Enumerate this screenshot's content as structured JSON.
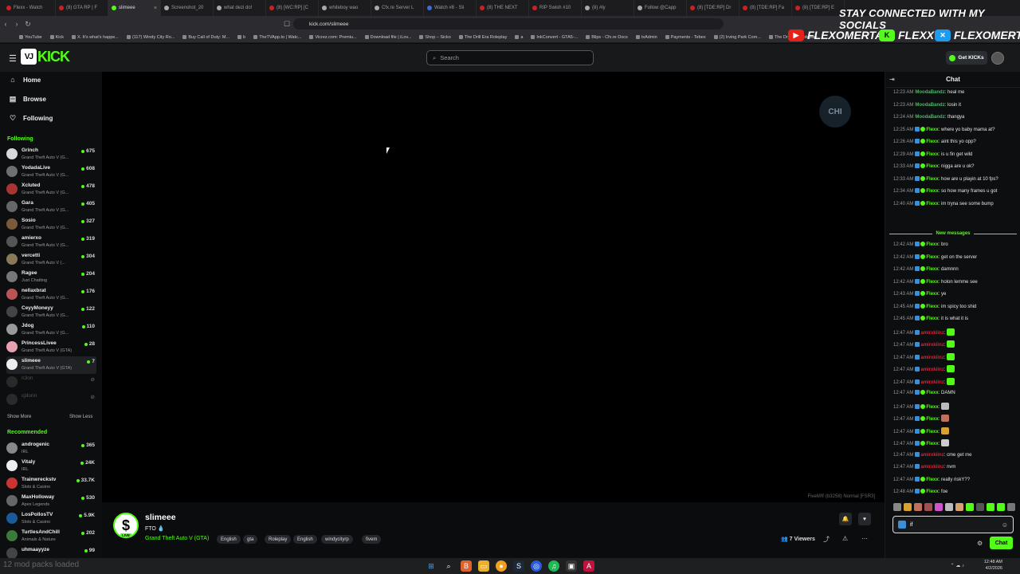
{
  "browser": {
    "tabs": [
      {
        "label": "Flexx - Watch",
        "icon": "red"
      },
      {
        "label": "(8) GTA RP | F",
        "icon": "red"
      },
      {
        "label": "slimeee",
        "icon": "green",
        "active": true
      },
      {
        "label": "Screenshot_20",
        "icon": "white"
      },
      {
        "label": "what dezi do!",
        "icon": "white"
      },
      {
        "label": "(8) [WC:RP] [C",
        "icon": "red"
      },
      {
        "label": "whiteboy wao",
        "icon": "white"
      },
      {
        "label": "Cfx.re Server L",
        "icon": "white"
      },
      {
        "label": "Watch #8 - Sli",
        "icon": "blue"
      },
      {
        "label": "(8) THE NEXT",
        "icon": "red"
      },
      {
        "label": "RIP Swish #10",
        "icon": "red"
      },
      {
        "label": "(8) #ly",
        "icon": "white"
      },
      {
        "label": "Follow @Capp",
        "icon": "white"
      },
      {
        "label": "(8) [TDE:RP] Dr",
        "icon": "red"
      },
      {
        "label": "(8) [TDE:RP] Fa",
        "icon": "red"
      },
      {
        "label": "(8) [TDE:RP] E",
        "icon": "red"
      }
    ],
    "url": "kick.com/slimeee",
    "bookmarks": [
      "YouTube",
      "Kick",
      "X. It's what's happe...",
      "(117) Windy City Ro...",
      "Buy Call of Duty: M...",
      "b",
      "TheTVApp.to | Watc...",
      "Vicrez.com: Premiu...",
      "Download file | iLov...",
      "Shop – Sicko",
      "The Drill Era Roleplay",
      "a",
      "InkConvert - GTA5-...",
      "Blips - Cfx.re Docs",
      "txAdmin",
      "Payments - Tebex",
      "(2) Irving Park Com...",
      "The Drill Era Roleplay"
    ]
  },
  "overlay": {
    "headline": "STAY CONNECTED WITH MY SOCIALS",
    "handles": [
      {
        "name": "FLEXOMERTA",
        "icon": "youtube-icon",
        "color": "#e62117"
      },
      {
        "name": "FLEXX",
        "icon": "kick-icon",
        "color": "#53fc18"
      },
      {
        "name": "FLEXOMERTA",
        "icon": "twitter-icon",
        "color": "#1d9bf0"
      }
    ]
  },
  "header": {
    "logo_text": "KICK",
    "search_placeholder": "Search",
    "get_kicks": "Get KICKs"
  },
  "nav": {
    "home": "Home",
    "browse": "Browse",
    "following": "Following"
  },
  "sidebar": {
    "following_title": "Following",
    "following": [
      {
        "name": "Grinch",
        "category": "Grand Theft Auto V (G...",
        "viewers": "675",
        "avatar": "#d8d8d8"
      },
      {
        "name": "YodadaLive",
        "category": "Grand Theft Auto V (G...",
        "viewers": "608",
        "avatar": "#6f6f6f"
      },
      {
        "name": "Xcluted",
        "category": "Grand Theft Auto V (G...",
        "viewers": "478",
        "avatar": "#a33"
      },
      {
        "name": "Gara",
        "category": "Grand Theft Auto V (G...",
        "viewers": "405",
        "avatar": "#666"
      },
      {
        "name": "Sosio",
        "category": "Grand Theft Auto V (G...",
        "viewers": "327",
        "avatar": "#7a5a3a"
      },
      {
        "name": "amierxo",
        "category": "Grand Theft Auto V (G...",
        "viewers": "319",
        "avatar": "#555"
      },
      {
        "name": "vercetti",
        "category": "Grand Theft Auto V (...",
        "viewers": "304",
        "avatar": "#8a7a5a"
      },
      {
        "name": "Ragee",
        "category": "Just Chatting",
        "viewers": "204",
        "avatar": "#777"
      },
      {
        "name": "nellaxbrat",
        "category": "Grand Theft Auto V (G...",
        "viewers": "176",
        "avatar": "#b55"
      },
      {
        "name": "CeyyMoneyy",
        "category": "Grand Theft Auto V (G...",
        "viewers": "122",
        "avatar": "#444"
      },
      {
        "name": "Jdog",
        "category": "Grand Theft Auto V (G...",
        "viewers": "110",
        "avatar": "#999"
      },
      {
        "name": "PrincessLivee",
        "category": "Grand Theft Auto V (GTA)",
        "viewers": "28",
        "avatar": "#e8a0b0"
      },
      {
        "name": "slimeee",
        "category": "Grand Theft Auto V (GTA)",
        "viewers": "7",
        "avatar": "#eee"
      }
    ],
    "offline": [
      "n3on",
      "cjdonn"
    ],
    "show_more": "Show More",
    "show_less": "Show Less",
    "recommended_title": "Recommended",
    "recommended": [
      {
        "name": "androgenic",
        "category": "IRL",
        "viewers": "365",
        "avatar": "#888"
      },
      {
        "name": "Vitaly",
        "category": "IRL",
        "viewers": "24K",
        "avatar": "#eee"
      },
      {
        "name": "Trainwreckstv",
        "category": "Slots & Casino",
        "viewers": "33.7K",
        "avatar": "#c33"
      },
      {
        "name": "MaxHolloway",
        "category": "Apex Legends",
        "viewers": "530",
        "avatar": "#666"
      },
      {
        "name": "LosPollosTV",
        "category": "Slots & Casino",
        "viewers": "5.9K",
        "avatar": "#1a5a9a"
      },
      {
        "name": "TurtlesAndChill",
        "category": "Animals & Nature",
        "viewers": "202",
        "avatar": "#3a7a3a"
      },
      {
        "name": "uhmaayyze",
        "category": "",
        "viewers": "99",
        "avatar": "#444"
      }
    ]
  },
  "player": {
    "watermark": "CHI",
    "fivem": "FiveM® (b3258) Normal [FSR3]"
  },
  "stream": {
    "name": "slimeee",
    "title": "FTO",
    "category": "Grand Theft Auto V (GTA)",
    "tags": [
      "English",
      "gta",
      "Roleplay",
      "English",
      "windycityrp",
      "fivem"
    ],
    "viewers": "7 Viewers"
  },
  "chat": {
    "title": "Chat",
    "new_messages": "New messages",
    "messages": [
      {
        "time": "12:23 AM",
        "user": "MoodaBandz",
        "color": "#4fb56a",
        "badges": [],
        "text": "heal me"
      },
      {
        "time": "12:23 AM",
        "user": "MoodaBandz",
        "color": "#4fb56a",
        "badges": [],
        "text": "losin it"
      },
      {
        "time": "12:24 AM",
        "user": "MoodaBandz",
        "color": "#4fb56a",
        "badges": [],
        "text": "thangya"
      },
      {
        "time": "12:25 AM",
        "user": "Flexx",
        "color": "#53fc18",
        "badges": [
          "blue",
          "green"
        ],
        "text": "where yo baby mama at?"
      },
      {
        "time": "12:26 AM",
        "user": "Flexx",
        "color": "#53fc18",
        "badges": [
          "blue",
          "green"
        ],
        "text": "aint this yo opp?"
      },
      {
        "time": "12:29 AM",
        "user": "Flexx",
        "color": "#53fc18",
        "badges": [
          "blue",
          "green"
        ],
        "text": "is u fin get wild"
      },
      {
        "time": "12:33 AM",
        "user": "Flexx",
        "color": "#53fc18",
        "badges": [
          "blue",
          "green"
        ],
        "text": "nigga are u ok?"
      },
      {
        "time": "12:33 AM",
        "user": "Flexx",
        "color": "#53fc18",
        "badges": [
          "blue",
          "green"
        ],
        "text": "how are u playin at 10 fps?"
      },
      {
        "time": "12:34 AM",
        "user": "Flexx",
        "color": "#53fc18",
        "badges": [
          "blue",
          "green"
        ],
        "text": "so how many frames u got"
      },
      {
        "time": "12:40 AM",
        "user": "Flexx",
        "color": "#53fc18",
        "badges": [
          "blue",
          "green"
        ],
        "text": "im tryna see some bump"
      },
      {
        "time": "12:42 AM",
        "user": "Flexx",
        "color": "#53fc18",
        "badges": [
          "blue",
          "green"
        ],
        "text": "bro"
      },
      {
        "time": "12:42 AM",
        "user": "Flexx",
        "color": "#53fc18",
        "badges": [
          "blue",
          "green"
        ],
        "text": "get on the server"
      },
      {
        "time": "12:42 AM",
        "user": "Flexx",
        "color": "#53fc18",
        "badges": [
          "blue",
          "green"
        ],
        "text": "damnnn"
      },
      {
        "time": "12:42 AM",
        "user": "Flexx",
        "color": "#53fc18",
        "badges": [
          "blue",
          "green"
        ],
        "text": "holon lemme see"
      },
      {
        "time": "12:43 AM",
        "user": "Flexx",
        "color": "#53fc18",
        "badges": [
          "blue",
          "green"
        ],
        "text": "ye"
      },
      {
        "time": "12:45 AM",
        "user": "Flexx",
        "color": "#53fc18",
        "badges": [
          "blue",
          "green"
        ],
        "text": "im spicy too shid"
      },
      {
        "time": "12:45 AM",
        "user": "Flexx",
        "color": "#53fc18",
        "badges": [
          "blue",
          "green"
        ],
        "text": "it is what it is"
      },
      {
        "time": "12:47 AM",
        "user": "amirxkiinz",
        "color": "#d8243a",
        "badges": [
          "blue"
        ],
        "text": "",
        "emote": "#53fc18"
      },
      {
        "time": "12:47 AM",
        "user": "amirxkiinz",
        "color": "#d8243a",
        "badges": [
          "blue"
        ],
        "text": "",
        "emote": "#53fc18"
      },
      {
        "time": "12:47 AM",
        "user": "amirxkiinz",
        "color": "#d8243a",
        "badges": [
          "blue"
        ],
        "text": "",
        "emote": "#53fc18"
      },
      {
        "time": "12:47 AM",
        "user": "amirxkiinz",
        "color": "#d8243a",
        "badges": [
          "blue"
        ],
        "text": "",
        "emote": "#53fc18"
      },
      {
        "time": "12:47 AM",
        "user": "amirxkiinz",
        "color": "#d8243a",
        "badges": [
          "blue"
        ],
        "text": "",
        "emote": "#53fc18"
      },
      {
        "time": "12:47 AM",
        "user": "Flexx",
        "color": "#53fc18",
        "badges": [
          "blue",
          "green"
        ],
        "text": "DAMN"
      },
      {
        "time": "12:47 AM",
        "user": "Flexx",
        "color": "#53fc18",
        "badges": [
          "blue",
          "green"
        ],
        "text": "",
        "emote": "#bbbbbb"
      },
      {
        "time": "12:47 AM",
        "user": "Flexx",
        "color": "#53fc18",
        "badges": [
          "blue",
          "green"
        ],
        "text": "",
        "emote": "#c0705a"
      },
      {
        "time": "12:47 AM",
        "user": "Flexx",
        "color": "#53fc18",
        "badges": [
          "blue",
          "green"
        ],
        "text": "",
        "emote": "#d8a030"
      },
      {
        "time": "12:47 AM",
        "user": "Flexx",
        "color": "#53fc18",
        "badges": [
          "blue",
          "green"
        ],
        "text": "",
        "emote": "#cccccc"
      },
      {
        "time": "12:47 AM",
        "user": "amirxkiinz",
        "color": "#d8243a",
        "badges": [
          "blue"
        ],
        "text": "cme get me"
      },
      {
        "time": "12:47 AM",
        "user": "amirxkiinz",
        "color": "#d8243a",
        "badges": [
          "blue"
        ],
        "text": "nvm"
      },
      {
        "time": "12:47 AM",
        "user": "Flexx",
        "color": "#53fc18",
        "badges": [
          "blue",
          "green"
        ],
        "text": "really riskY??"
      },
      {
        "time": "12:48 AM",
        "user": "Flexx",
        "color": "#53fc18",
        "badges": [
          "blue",
          "green"
        ],
        "text": "foe"
      }
    ],
    "input_value": "if",
    "send_label": "Chat",
    "quick_emotes": [
      "#888",
      "#d8a030",
      "#c0705a",
      "#a05050",
      "#cc55cc",
      "#bbb",
      "#d8a070",
      "#53fc18",
      "#555",
      "#53fc18",
      "#53fc18",
      "#777"
    ]
  },
  "taskbar": {
    "overlay_text": "12 mod packs loaded",
    "time": "12:48 AM",
    "date": "4/2/2026"
  }
}
